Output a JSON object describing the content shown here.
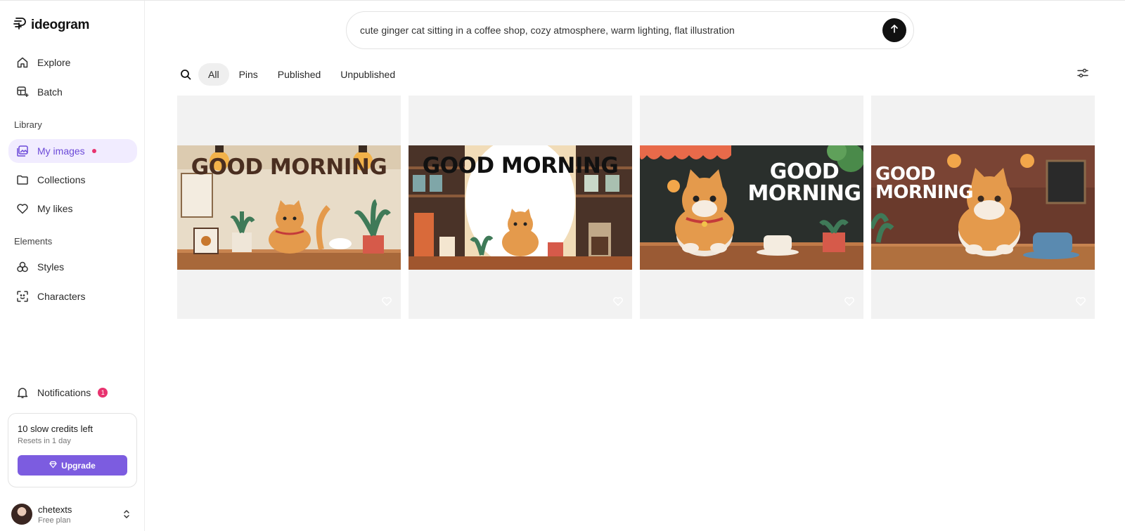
{
  "app": {
    "name": "ideogram"
  },
  "sidebar": {
    "nav": [
      {
        "label": "Explore",
        "icon": "home-icon"
      },
      {
        "label": "Batch",
        "icon": "batch-icon"
      }
    ],
    "library_label": "Library",
    "library": [
      {
        "label": "My images",
        "icon": "images-icon",
        "active": true
      },
      {
        "label": "Collections",
        "icon": "folder-icon"
      },
      {
        "label": "My likes",
        "icon": "heart-icon"
      }
    ],
    "elements_label": "Elements",
    "elements": [
      {
        "label": "Styles",
        "icon": "styles-icon"
      },
      {
        "label": "Characters",
        "icon": "characters-icon"
      }
    ],
    "notifications": {
      "label": "Notifications",
      "count": "1"
    },
    "credits": {
      "title": "10 slow credits left",
      "subtitle": "Resets in 1 day",
      "upgrade_label": "Upgrade"
    },
    "user": {
      "name": "chetexts",
      "plan": "Free plan"
    }
  },
  "prompt": {
    "text": "cute ginger cat sitting in a coffee shop, cozy atmosphere, warm lighting, flat illustration"
  },
  "filters": {
    "tabs": [
      "All",
      "Pins",
      "Published",
      "Unpublished"
    ],
    "active": "All"
  },
  "images": [
    {
      "caption": "GOOD MORNING",
      "style": "light"
    },
    {
      "caption": "GOOD MORNING",
      "style": "shelves"
    },
    {
      "caption": "GOOD MORNING",
      "style": "dark"
    },
    {
      "caption": "GOOD MORNING",
      "style": "brick"
    }
  ],
  "colors": {
    "accent": "#7c5ce0",
    "active_bg": "#f1ecff",
    "badge": "#e8336f"
  }
}
